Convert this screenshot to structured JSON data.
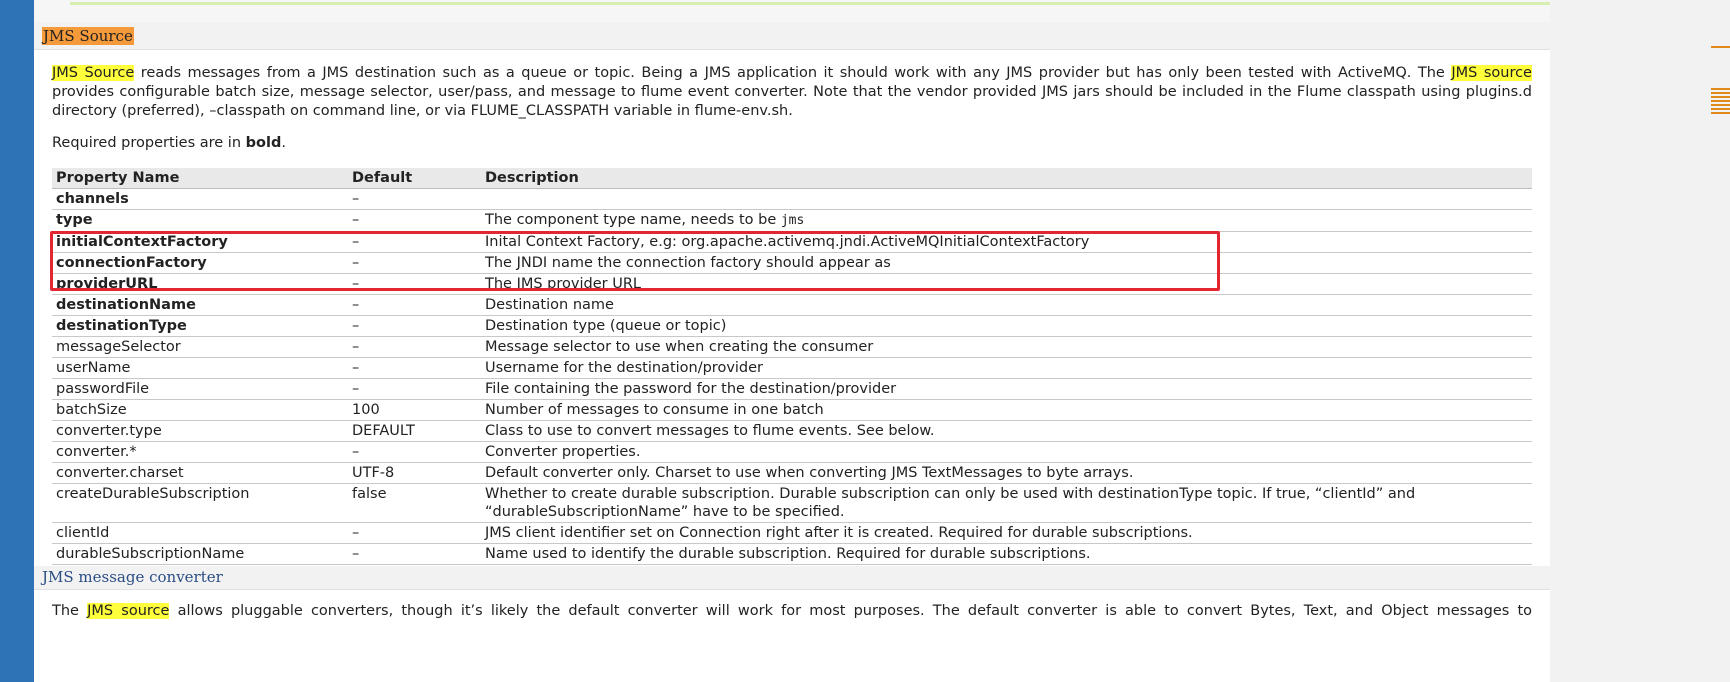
{
  "section_title": "JMS Source",
  "intro": {
    "l1_hl1": "JMS Source",
    "l1_text": " reads messages from a JMS destination such as a queue or topic. Being a JMS application it should work with any JMS provider but has only been tested with ActiveMQ. The ",
    "l1_hl2": "JMS source",
    "l2": "provides configurable batch size, message selector, user/pass, and message to flume event converter. Note that the vendor provided JMS jars should be included in the Flume classpath using plugins.d",
    "l3": "directory (preferred), –classpath on command line, or via FLUME_CLASSPATH variable in flume-env.sh."
  },
  "required_note": {
    "before": "Required properties are in ",
    "bold": "bold",
    "after": "."
  },
  "table": {
    "headers": [
      "Property Name",
      "Default",
      "Description"
    ],
    "rows": [
      {
        "name": "channels",
        "default": "–",
        "desc": ""
      },
      {
        "name": "type",
        "default": "–",
        "desc": "The component type name, needs to be ",
        "code": "jms"
      },
      {
        "name": "initialContextFactory",
        "default": "–",
        "desc": "Inital Context Factory, e.g: org.apache.activemq.jndi.ActiveMQInitialContextFactory"
      },
      {
        "name": "connectionFactory",
        "default": "–",
        "desc": "The JNDI name the connection factory should appear as"
      },
      {
        "name": "providerURL",
        "default": "–",
        "desc": "The JMS provider URL"
      },
      {
        "name": "destinationName",
        "default": "–",
        "desc": "Destination name"
      },
      {
        "name": "destinationType",
        "default": "–",
        "desc": "Destination type (queue or topic)"
      },
      {
        "name": "messageSelector",
        "default": "–",
        "desc": "Message selector to use when creating the consumer"
      },
      {
        "name": "userName",
        "default": "–",
        "desc": "Username for the destination/provider"
      },
      {
        "name": "passwordFile",
        "default": "–",
        "desc": "File containing the password for the destination/provider"
      },
      {
        "name": "batchSize",
        "default": "100",
        "desc": "Number of messages to consume in one batch"
      },
      {
        "name": "converter.type",
        "default": "DEFAULT",
        "desc": "Class to use to convert messages to flume events. See below."
      },
      {
        "name": "converter.*",
        "default": "–",
        "desc": "Converter properties."
      },
      {
        "name": "converter.charset",
        "default": "UTF-8",
        "desc": "Default converter only. Charset to use when converting JMS TextMessages to byte arrays."
      },
      {
        "name": "createDurableSubscription",
        "default": "false",
        "desc": "Whether to create durable subscription. Durable subscription can only be used with destinationType topic. If true, “clientId” and",
        "desc2": "“durableSubscriptionName” have to be specified."
      },
      {
        "name": "clientId",
        "default": "–",
        "desc": "JMS client identifier set on Connection right after it is created. Required for durable subscriptions."
      },
      {
        "name": "durableSubscriptionName",
        "default": "–",
        "desc": "Name used to identify the durable subscription. Required for durable subscriptions."
      }
    ]
  },
  "subsection_title": "JMS message converter",
  "bottom": {
    "before": "The ",
    "hl": "JMS source",
    "after": " allows pluggable converters, though it’s likely the default converter will work for most purposes. The default converter is able to convert Bytes, Text, and Object messages to"
  },
  "colors": {
    "left_bar": "#2e73b6",
    "title_highlight": "#f59a3a",
    "search_highlight": "#ffff3b",
    "annotation_box": "#e22632",
    "subheading_text": "#2a4d85"
  }
}
